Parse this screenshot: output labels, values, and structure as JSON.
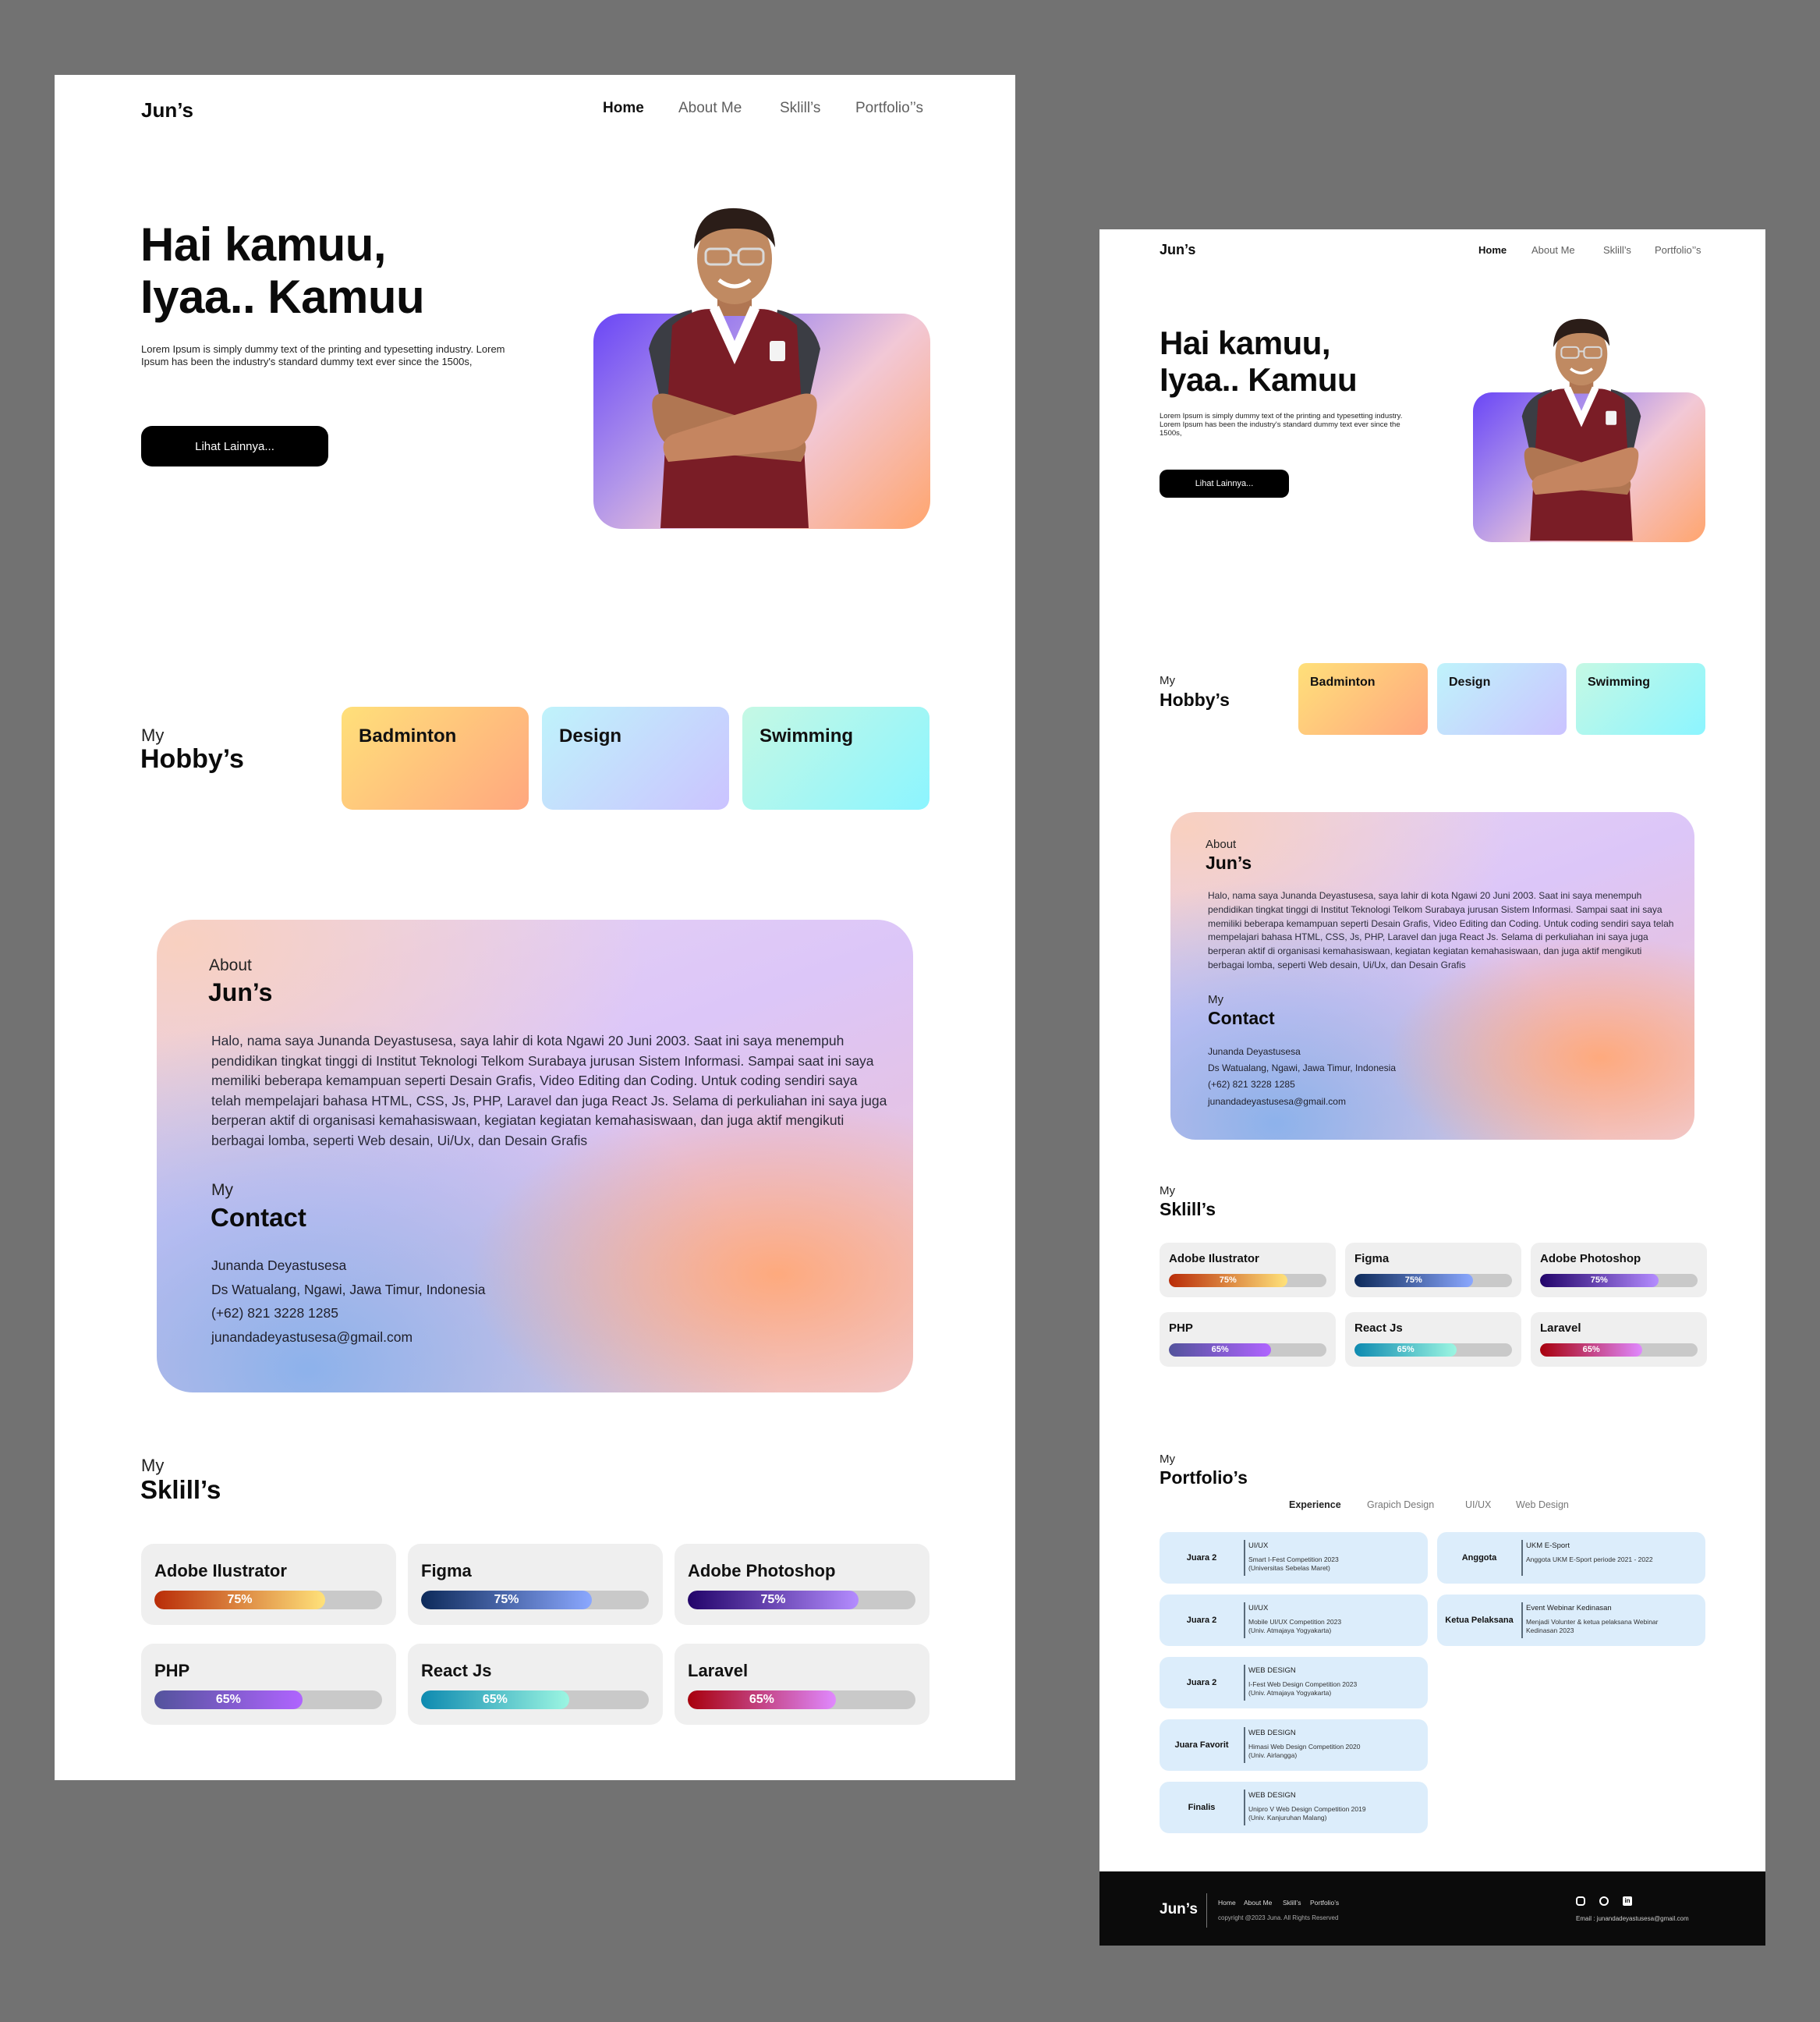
{
  "brand": "Jun’s",
  "nav": {
    "home": "Home",
    "about": "About Me",
    "skills": "Sklill’s",
    "portfolio": "Portfolio’’s"
  },
  "hero": {
    "title_line1": "Hai kamuu,",
    "title_line2": "Iyaa.. Kamuu",
    "desc": "Lorem Ipsum is simply dummy text of the printing and typesetting industry. Lorem Ipsum has been the industry's standard dummy text ever since the 1500s,",
    "cta": "Lihat Lainnya..."
  },
  "hobby": {
    "small": "My",
    "big": "Hobby’s",
    "items": [
      "Badminton",
      "Design",
      "Swimming"
    ]
  },
  "about": {
    "small": "About",
    "big": "Jun’s",
    "text": "Halo, nama saya Junanda Deyastusesa, saya lahir di kota Ngawi 20 Juni 2003. Saat ini saya menempuh pendidikan tingkat tinggi di Institut Teknologi Telkom Surabaya jurusan Sistem Informasi. Sampai saat ini saya memiliki beberapa kemampuan seperti Desain Grafis, Video Editing dan Coding. Untuk coding sendiri saya telah mempelajari bahasa HTML, CSS, Js, PHP, Laravel dan juga React Js. Selama di perkuliahan ini saya juga berperan aktif di organisasi kemahasiswaan, kegiatan kegiatan kemahasiswaan, dan juga aktif mengikuti berbagai lomba, seperti Web desain, Ui/Ux, dan Desain Grafis"
  },
  "contact": {
    "small": "My",
    "big": "Contact",
    "name": "Junanda Deyastusesa",
    "address": "Ds Watualang, Ngawi, Jawa Timur, Indonesia",
    "phone": "(+62) 821 3228 1285",
    "email": "junandadeyastusesa@gmail.com"
  },
  "skills": {
    "small": "My",
    "big": "Sklill’s",
    "items": [
      {
        "name": "Adobe Ilustrator",
        "percent": 75,
        "label": "75%",
        "colors": [
          "#b92c08",
          "#ffe27a"
        ]
      },
      {
        "name": "Figma",
        "percent": 75,
        "label": "75%",
        "colors": [
          "#0d2a5a",
          "#8ba8ff"
        ]
      },
      {
        "name": "Adobe Photoshop",
        "percent": 75,
        "label": "75%",
        "colors": [
          "#22046a",
          "#b48cff"
        ]
      },
      {
        "name": "PHP",
        "percent": 65,
        "label": "65%",
        "colors": [
          "#53539c",
          "#b064ff"
        ]
      },
      {
        "name": "React Js",
        "percent": 65,
        "label": "65%",
        "colors": [
          "#0e8ab0",
          "#9cf6e2"
        ]
      },
      {
        "name": "Laravel",
        "percent": 65,
        "label": "65%",
        "colors": [
          "#a8000c",
          "#e089ff"
        ]
      }
    ]
  },
  "portfolio": {
    "small": "My",
    "big": "Portfolio’s",
    "tabs": [
      "Experience",
      "Grapich Design",
      "UI/UX",
      "Web Design"
    ],
    "left": [
      {
        "rank": "Juara 2",
        "cat": "UI/UX",
        "line1": "Smart I-Fest Competition 2023",
        "line2": "(Universitas Sebelas Maret)"
      },
      {
        "rank": "Juara 2",
        "cat": "UI/UX",
        "line1": "Mobile UI/UX Competition 2023",
        "line2": "(Univ. Atmajaya Yogyakarta)"
      },
      {
        "rank": "Juara 2",
        "cat": "WEB DESIGN",
        "line1": "I-Fest Web Design Competition 2023",
        "line2": "(Univ. Atmajaya Yogyakarta)"
      },
      {
        "rank": "Juara Favorit",
        "cat": "WEB DESIGN",
        "line1": "Himasi Web Design Competition 2020",
        "line2": "(Univ. Airlangga)"
      },
      {
        "rank": "Finalis",
        "cat": "WEB DESIGN",
        "line1": "Unipro V Web Design Competition 2019",
        "line2": "(Univ. Kanjuruhan Malang)"
      }
    ],
    "right": [
      {
        "rank": "Anggota",
        "cat": "UKM E-Sport",
        "line1": "Anggota UKM E-Sport periode 2021 - 2022",
        "line2": ""
      },
      {
        "rank": "Ketua Pelaksana",
        "cat": "Event Webinar Kedinasan",
        "line1": "Menjadi Volunter & ketua pelaksana Webinar",
        "line2": "Kedinasan 2023"
      }
    ]
  },
  "footer": {
    "links": [
      "Home",
      "About Me",
      "Sklill’s",
      "Portfolio’s"
    ],
    "copyright": "copyright @2023 Juna. All Rights Reserved",
    "email": "Email : junandadeyastusesa@gmail.com",
    "icons": [
      "instagram-icon",
      "github-icon",
      "linkedin-icon"
    ]
  },
  "colors": {
    "background": "#727272",
    "black": "#000000",
    "portfolio_card": "#dcedfb",
    "skill_card": "#efefef"
  }
}
